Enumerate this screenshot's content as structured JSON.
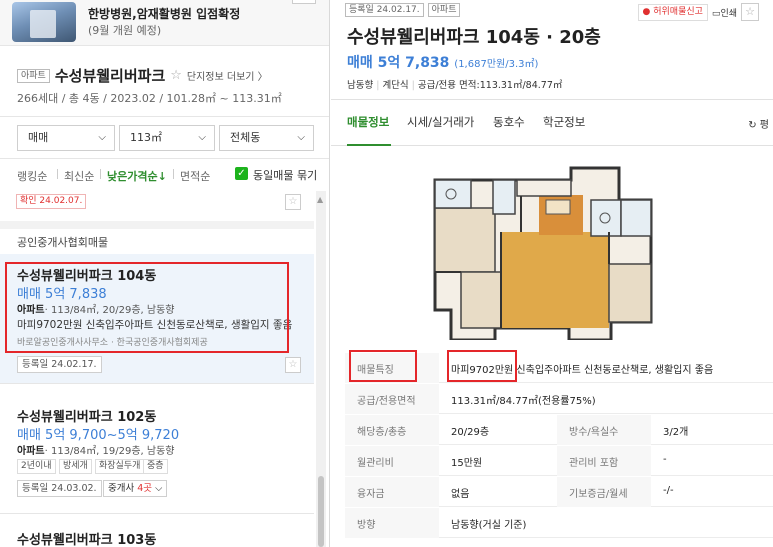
{
  "promo": {
    "title": "한방병원,암재활병원 입점확정",
    "subtitle": "(9월 개원 예정)"
  },
  "complex": {
    "type_tag": "아파트",
    "name": "수성뷰웰리버파크",
    "more_link": "단지정보 더보기 〉",
    "info": "266세대 / 총 4동 / 2023.02 / 101.28㎡ ~ 113.31㎡"
  },
  "filters": {
    "trade": "매매",
    "area": "113㎡",
    "dong": "전체동"
  },
  "sort": {
    "items": [
      "랭킹순",
      "최신순",
      "낮은가격순↓",
      "면적순"
    ],
    "active_index": 2,
    "group_label": "동일매물 묶기",
    "group_checked": true
  },
  "listing_prev": {
    "badge": "확인 24.02.07."
  },
  "section_title": "공인중개사협회매물",
  "listings": [
    {
      "name": "수성뷰웰리버파크 104동",
      "price": "매매 5억 7,838",
      "spec_type": "아파트",
      "spec": "· 113/84㎡, 20/29층, 남동향",
      "desc": "마피9702만원 신축입주아파트 신천동로산책로, 생활입지 좋음",
      "agent": "바로알공인중개사사무소 · 한국공인중개사협회제공",
      "date": "등록일 24.02.17."
    },
    {
      "name": "수성뷰웰리버파크 102동",
      "price": "매매 5억 9,700~5억 9,720",
      "spec_type": "아파트",
      "spec": "· 113/84㎡, 19/29층, 남동향",
      "chips": [
        "2년이내",
        "방세개",
        "화장실두개",
        "중층"
      ],
      "date": "등록일 24.03.02.",
      "agent_count_prefix": "중개사",
      "agent_count": "4곳",
      "agent_count_suffix": "⌵"
    },
    {
      "name": "수성뷰웰리버파크 103동"
    }
  ],
  "detail": {
    "date_tag": "등록일 24.02.17.",
    "type_tag": "아파트",
    "report": "허위매물신고",
    "print": "인쇄",
    "title": "수성뷰웰리버파크 104동 · 20층",
    "price": "매매 5억 7,838",
    "price_per": "(1,687만원/3.3㎡)",
    "meta_direction": "남동향",
    "meta_stairs": "계단식",
    "meta_area": "공급/전용 면적:113.31㎡/84.77㎡",
    "tabs": [
      "매물정보",
      "시세/실거래가",
      "동호수",
      "학군정보"
    ],
    "active_tab": 0,
    "tab_right": "평",
    "rows": [
      {
        "label": "매물특징",
        "value": "마피9702만원 신축입주아파트 신천동로산책로, 생활입지 좋음"
      },
      {
        "label": "공급/전용면적",
        "value": "113.31㎡/84.77㎡(전용률75%)"
      },
      {
        "label": "해당층/총층",
        "value": "20/29층",
        "label2": "방수/욕실수",
        "value2": "3/2개"
      },
      {
        "label": "월관리비",
        "value": "15만원",
        "label2": "관리비 포함",
        "value2": "-"
      },
      {
        "label": "융자금",
        "value": "없음",
        "label2": "기보증금/월세",
        "value2": "-/-"
      },
      {
        "label": "방향",
        "value": "남동향(거실 기준)"
      }
    ]
  },
  "colors": {
    "accent_green": "#2f8e2f",
    "price_blue": "#3d7fd6",
    "highlight_red": "#e4262a",
    "selected_bg": "#eef4fb"
  }
}
